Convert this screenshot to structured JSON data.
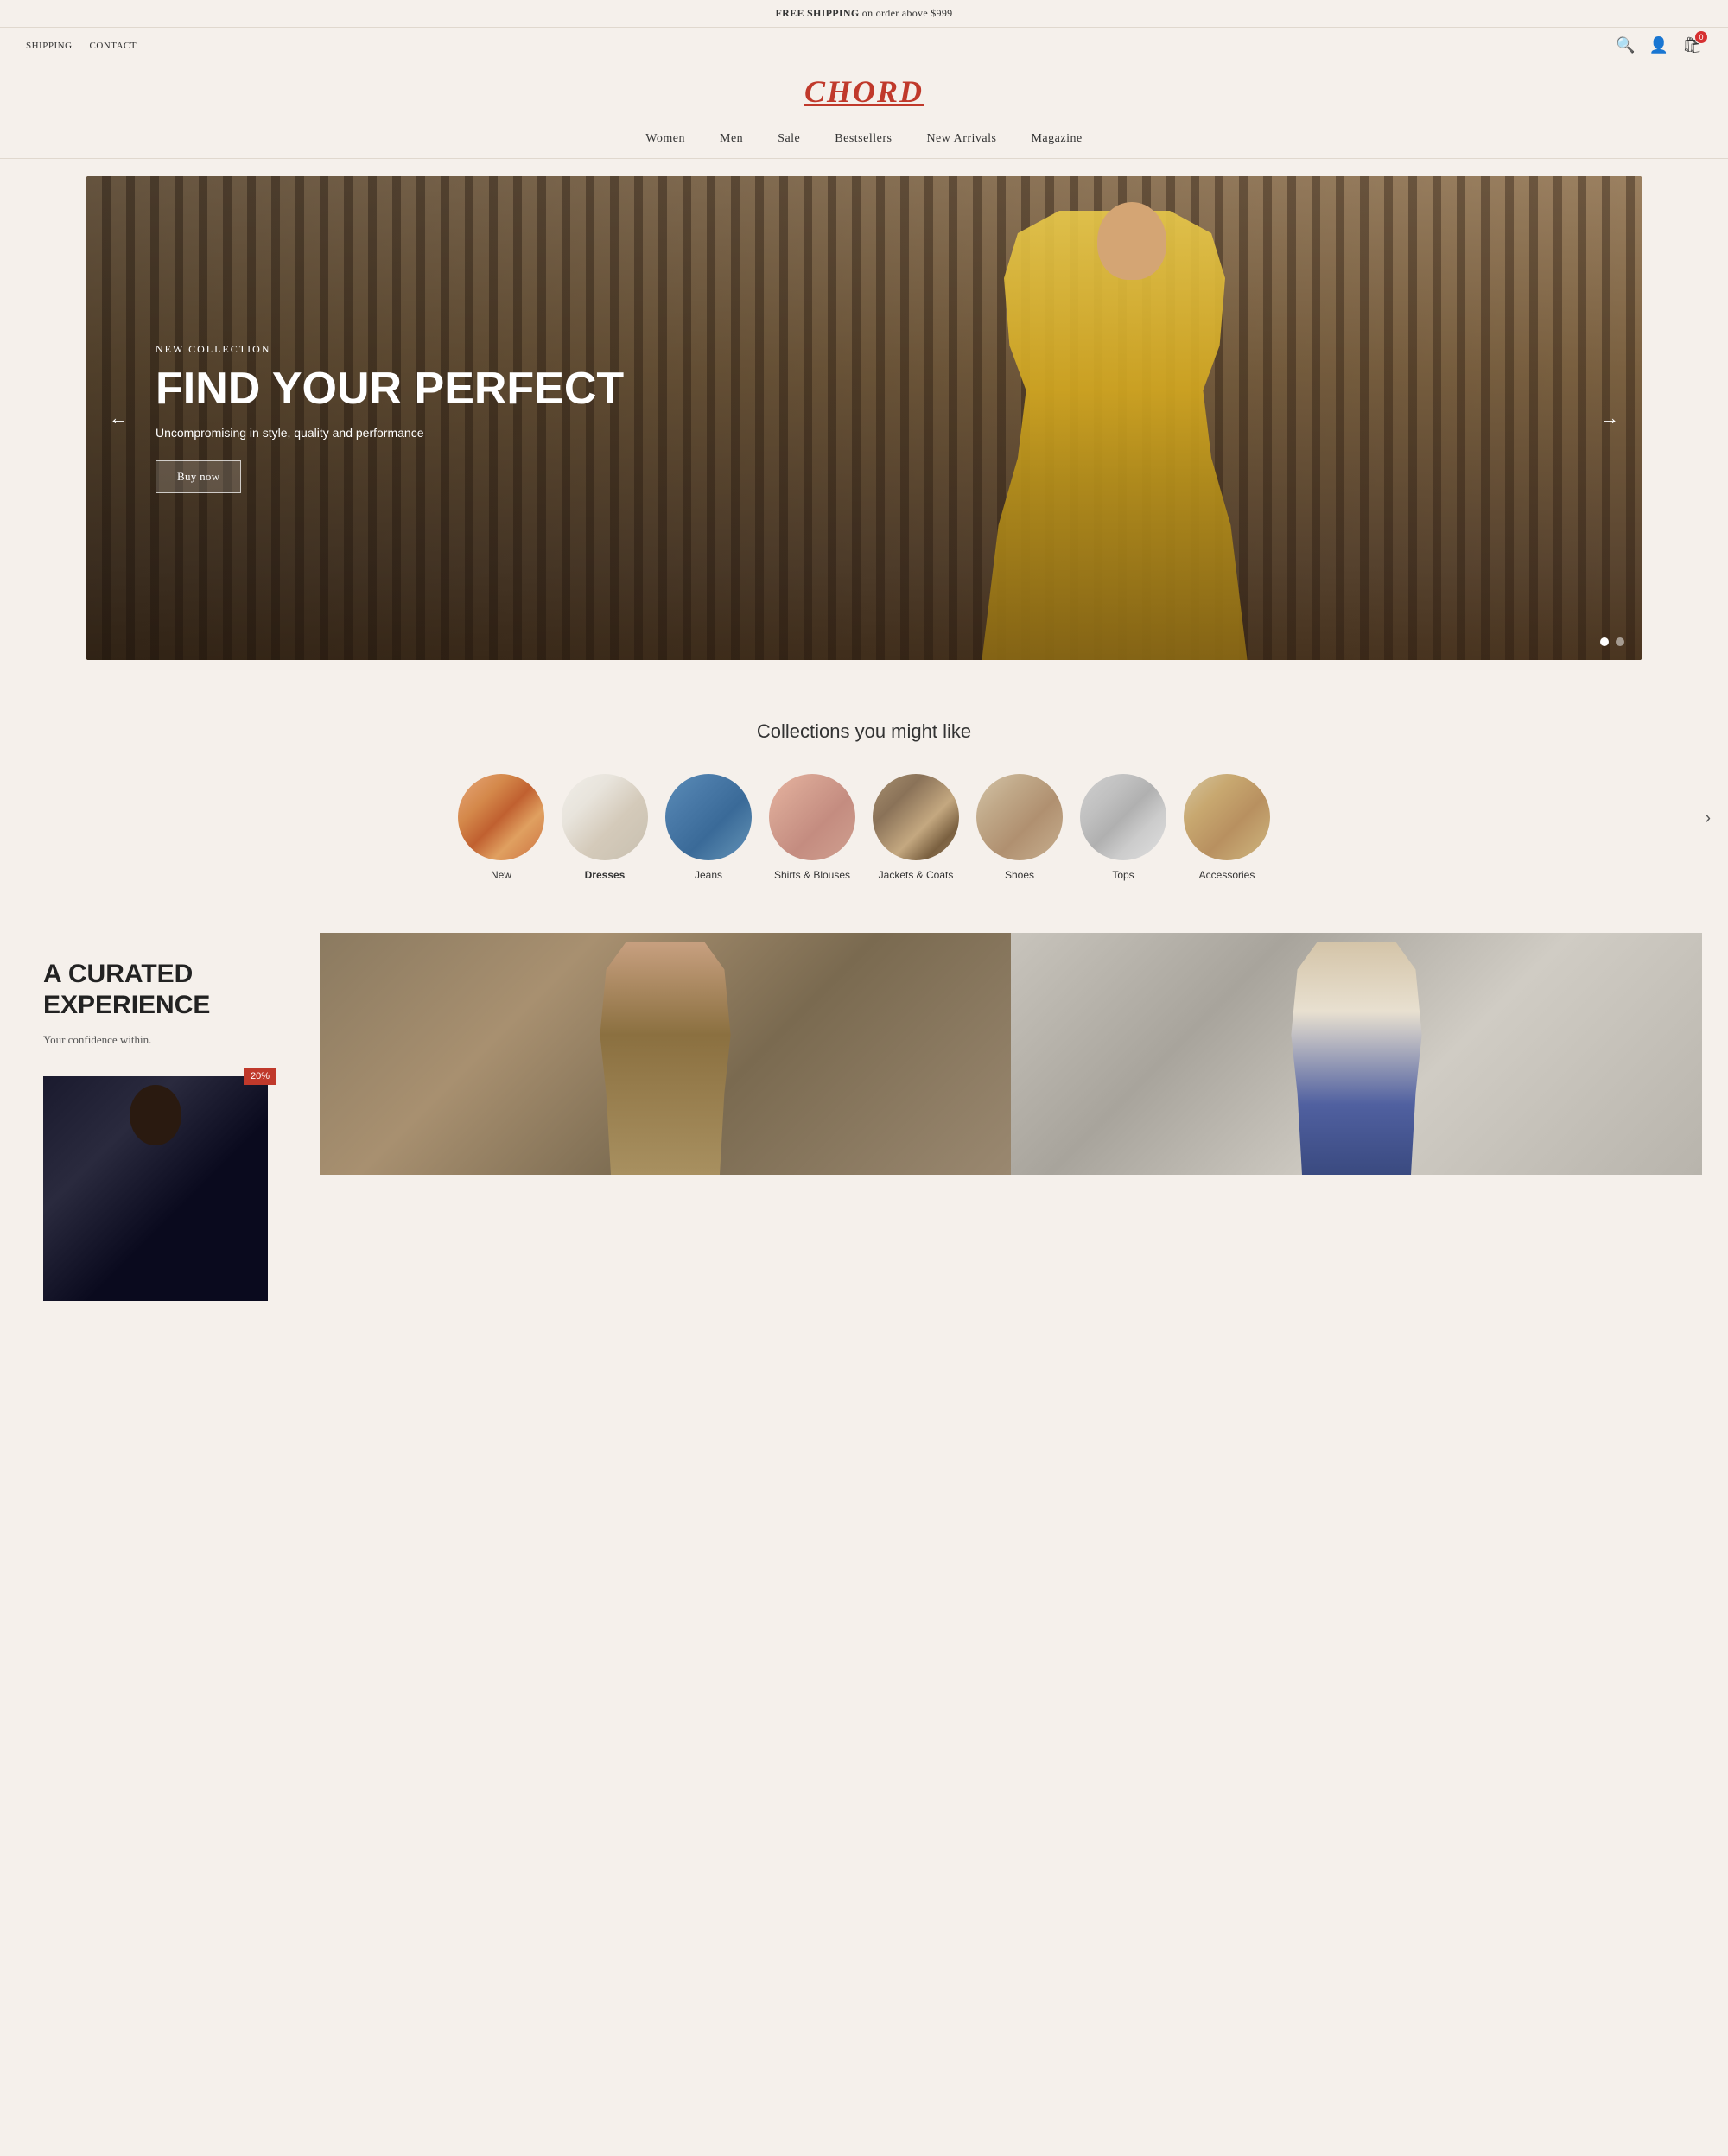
{
  "announcement": {
    "text_bold": "FREE SHIPPING",
    "text_normal": " on order above $999"
  },
  "utility_nav": {
    "left_links": [
      "SHIPPING",
      "CONTACT"
    ],
    "icons": {
      "search": "🔍",
      "account": "👤",
      "cart": "🛍"
    },
    "cart_count": "0"
  },
  "logo": {
    "text": "CHORD"
  },
  "main_nav": {
    "items": [
      {
        "label": "Women",
        "id": "nav-women"
      },
      {
        "label": "Men",
        "id": "nav-men"
      },
      {
        "label": "Sale",
        "id": "nav-sale"
      },
      {
        "label": "Bestsellers",
        "id": "nav-bestsellers"
      },
      {
        "label": "New Arrivals",
        "id": "nav-new-arrivals"
      },
      {
        "label": "Magazine",
        "id": "nav-magazine"
      }
    ]
  },
  "hero": {
    "subtitle": "NEW COLLECTION",
    "title": "FIND YOUR PERFECT",
    "description": "Uncompromising in style, quality and performance",
    "button_label": "Buy now",
    "arrow_left": "←",
    "arrow_right": "→"
  },
  "collections": {
    "section_title": "Collections you might like",
    "items": [
      {
        "label": "New",
        "circle_class": "circle-new",
        "bold": false
      },
      {
        "label": "Dresses",
        "circle_class": "circle-dresses",
        "bold": true
      },
      {
        "label": "Jeans",
        "circle_class": "circle-jeans",
        "bold": false
      },
      {
        "label": "Shirts & Blouses",
        "circle_class": "circle-shirts",
        "bold": false
      },
      {
        "label": "Jackets & Coats",
        "circle_class": "circle-jackets",
        "bold": false
      },
      {
        "label": "Shoes",
        "circle_class": "circle-shoes",
        "bold": false
      },
      {
        "label": "Tops",
        "circle_class": "circle-tops",
        "bold": false
      },
      {
        "label": "Accessories",
        "circle_class": "circle-accessories",
        "bold": false
      }
    ],
    "next_arrow": "›"
  },
  "curated": {
    "heading": "A CURATED EXPERIENCE",
    "description": "Your confidence within.",
    "promo_badge": "20%"
  }
}
